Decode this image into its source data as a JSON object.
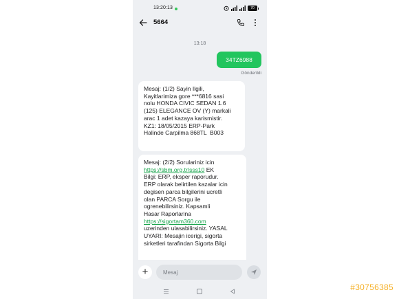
{
  "status_bar": {
    "time": "13:20:13",
    "battery": "70"
  },
  "header": {
    "contact": "5664"
  },
  "conversation": {
    "date_label": "13:18",
    "sent_message": "34TZ6988",
    "sent_status": "Gönderildi",
    "received_1": "Mesaj: (1/2) Sayin Ilgili,\nKayitlarimiza gore ***6816 sasi\nnolu HONDA CIVIC SEDAN 1.6\n(125) ELEGANCE OV (Y) markali\narac 1 adet kazaya karismistir.\nKZ1: 18/05/2015 ERP-Park\nHalinde Carpilma 868TL  B003",
    "received_2_prefix": "Mesaj: (2/2) Sorulariniz icin\n",
    "received_2_link1": "https://sbm.org.tr/sss10",
    "received_2_middle": " EK\nBilgi: ERP, eksper raporudur.\nERP olarak belirtilen kazalar icin\ndegisen parca bilgilerini ucretli\nolan PARCA Sorgu ile\nogrenebilirsiniz. Kapsamli\nHasar Raporlarina\n",
    "received_2_link2": "https://sigortam360.com",
    "received_2_suffix": "\nuzerinden ulasabilirsiniz. YASAL\nUYARI: Mesajin icerigi, sigorta\nsirketleri tarafindan Sigorta Bilgi"
  },
  "composer": {
    "placeholder": "Mesaj"
  },
  "watermark": "#30756385",
  "colors": {
    "accent": "#22c55e",
    "link": "#16a34a",
    "background": "#eef0f3",
    "watermark": "#f5b027"
  }
}
